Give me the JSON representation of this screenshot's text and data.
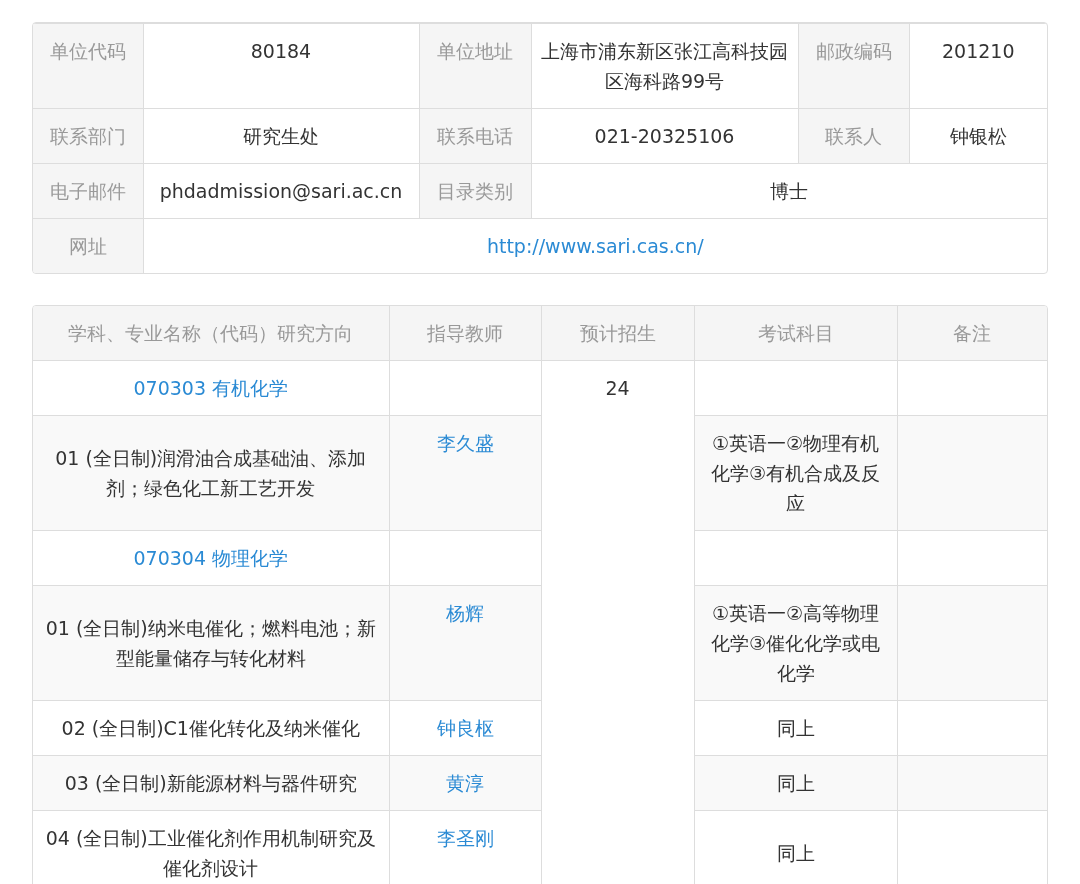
{
  "unit_info": {
    "rows": [
      [
        {
          "label": "单位代码",
          "value": "80184"
        },
        {
          "label": "单位地址",
          "value": "上海市浦东新区张江高科技园区海科路99号"
        },
        {
          "label": "邮政编码",
          "value": "201210"
        }
      ],
      [
        {
          "label": "联系部门",
          "value": "研究生处"
        },
        {
          "label": "联系电话",
          "value": "021-20325106"
        },
        {
          "label": "联系人",
          "value": "钟银松"
        }
      ],
      [
        {
          "label": "电子邮件",
          "value": "phdadmission@sari.ac.cn"
        },
        {
          "label": "目录类别",
          "value": "博士"
        }
      ],
      [
        {
          "label": "网址",
          "value": "http://www.sari.cas.cn/",
          "kind": "link"
        }
      ]
    ]
  },
  "program_table": {
    "columns": [
      "学科、专业名称（代码）研究方向",
      "指导教师",
      "预计招生",
      "考试科目",
      "备注"
    ],
    "enrollment": "24",
    "rows": [
      {
        "kind": "major",
        "name": "070303 有机化学"
      },
      {
        "kind": "direction",
        "name": "01 (全日制)润滑油合成基础油、添加剂；绿色化工新工艺开发",
        "advisor": "李久盛",
        "exam": "①英语一②物理有机化学③有机合成及反应"
      },
      {
        "kind": "major",
        "name": "070304 物理化学"
      },
      {
        "kind": "direction",
        "name": "01 (全日制)纳米电催化；燃料电池；新型能量储存与转化材料",
        "advisor": "杨辉",
        "exam": "①英语一②高等物理化学③催化化学或电化学"
      },
      {
        "kind": "direction",
        "name": "02 (全日制)C1催化转化及纳米催化",
        "advisor": "钟良枢",
        "exam": "同上"
      },
      {
        "kind": "direction",
        "name": "03 (全日制)新能源材料与器件研究",
        "advisor": "黄淳",
        "exam": "同上"
      },
      {
        "kind": "direction",
        "name": "04 (全日制)工业催化剂作用机制研究及催化剂设计",
        "advisor": "李圣刚",
        "exam": "同上"
      }
    ]
  }
}
